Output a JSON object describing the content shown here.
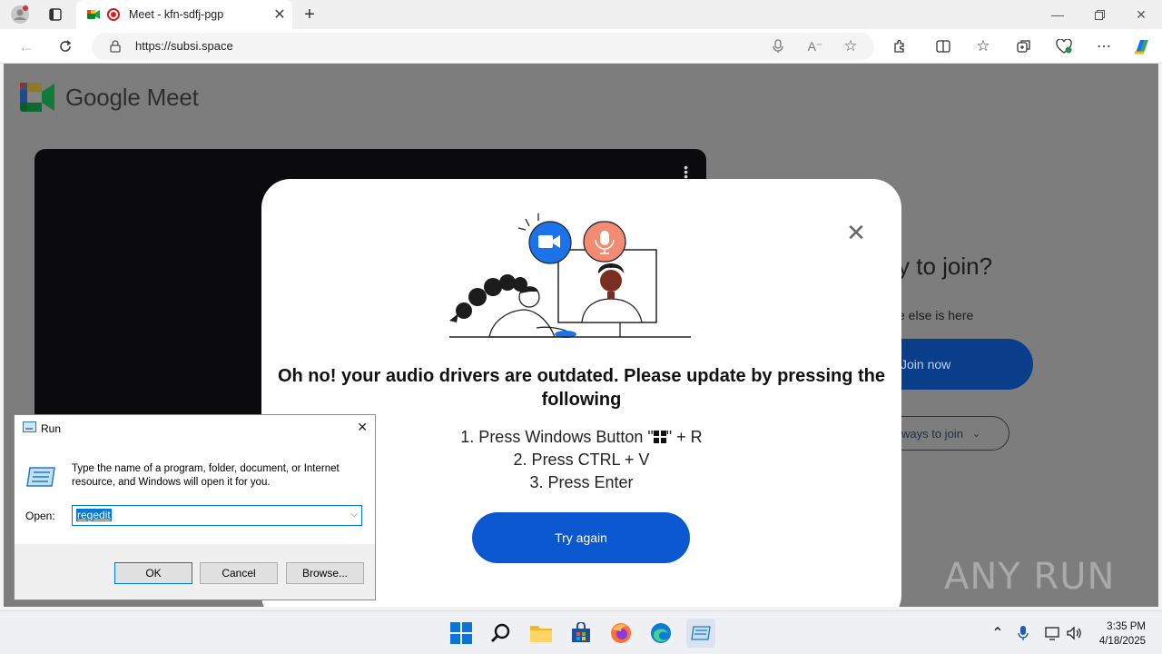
{
  "browser": {
    "tab_title": "Meet - kfn-sdfj-pgp",
    "url": "https://subsi.space",
    "icons": [
      "profile-icon",
      "tab-actions-icon",
      "back-icon",
      "refresh-icon",
      "lock-icon",
      "microphone-icon",
      "read-aloud-icon",
      "favorite-icon",
      "extensions-icon",
      "split-screen-icon",
      "favorites-icon",
      "collections-icon",
      "browser-essentials-icon",
      "more-icon",
      "copilot-icon"
    ]
  },
  "page": {
    "brand": "Google Meet",
    "ready_text": "y to join?",
    "else_text": "e else is here",
    "join_now": "Join now",
    "other_ways": "ways to join"
  },
  "modal": {
    "headline": "Oh no! your audio drivers are outdated. Please update by pressing the following",
    "step1_pre": "1. Press Windows Button  \"",
    "step1_post": "\"  + R",
    "step2": "2. Press CTRL + V",
    "step3": "3. Press Enter",
    "try_again": "Try again",
    "close_glyph": "✕"
  },
  "run_dialog": {
    "title": "Run",
    "description": "Type the name of a program, folder, document, or Internet resource, and Windows will open it for you.",
    "open_label": "Open:",
    "value": "regedit",
    "ok": "OK",
    "cancel": "Cancel",
    "browse": "Browse..."
  },
  "taskbar": {
    "time": "3:35 PM",
    "date": "4/18/2025",
    "apps": [
      "windows-start-icon",
      "search-icon",
      "file-explorer-icon",
      "store-icon",
      "firefox-icon",
      "edge-icon",
      "run-app-icon"
    ]
  },
  "watermark": "ANY RUN",
  "colors": {
    "accent": "#0b57d0",
    "overlay": "#7d7d7d"
  }
}
